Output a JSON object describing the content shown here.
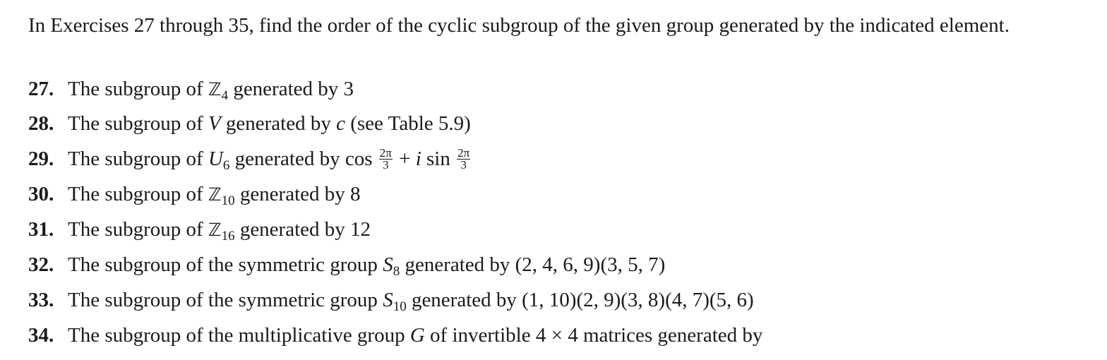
{
  "intro": "In Exercises 27 through 35, find the order of the cyclic subgroup of the given group generated by the indicated element.",
  "exercises": [
    {
      "number": "27.",
      "pre": "The subgroup of ",
      "group_symbol": "ℤ",
      "group_sub": "4",
      "post": " generated by 3"
    },
    {
      "number": "28.",
      "pre": "The subgroup of ",
      "group_symbol": "V",
      "mid": " generated by ",
      "gen": "c",
      "post": " (see Table 5.9)"
    },
    {
      "number": "29.",
      "pre": "The subgroup of ",
      "group_symbol": "U",
      "group_sub": "6",
      "mid": " generated by cos ",
      "frac_num": "2π",
      "frac_den": "3",
      "plus": " + ",
      "i": "i",
      "sin": " sin "
    },
    {
      "number": "30.",
      "pre": "The subgroup of ",
      "group_symbol": "ℤ",
      "group_sub": "10",
      "post": " generated by 8"
    },
    {
      "number": "31.",
      "pre": "The subgroup of ",
      "group_symbol": "ℤ",
      "group_sub": "16",
      "post": " generated by 12"
    },
    {
      "number": "32.",
      "pre": "The subgroup of the symmetric group ",
      "group_symbol": "S",
      "group_sub": "8",
      "post": " generated by (2, 4, 6, 9)(3, 5, 7)"
    },
    {
      "number": "33.",
      "pre": "The subgroup of the symmetric group ",
      "group_symbol": "S",
      "group_sub": "10",
      "post": " generated by (1, 10)(2, 9)(3, 8)(4, 7)(5, 6)"
    },
    {
      "number": "34.",
      "pre": "The subgroup of the multiplicative group ",
      "group_symbol": "G",
      "post": " of invertible 4 × 4 matrices generated by"
    }
  ]
}
